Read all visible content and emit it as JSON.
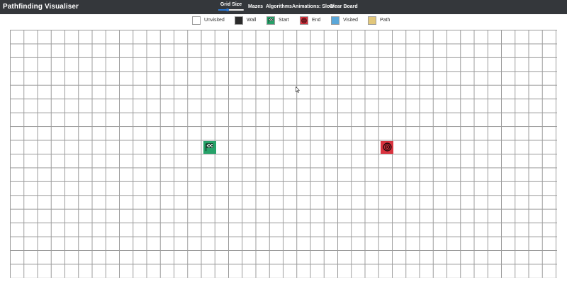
{
  "app": {
    "title": "Pathfinding Visualiser"
  },
  "nav": {
    "grid_size_label": "Grid Size",
    "grid_size_value": 0.35,
    "mazes_label": "Mazes",
    "algorithms_label": "Algorithms",
    "animations_label": "Animations: Slow",
    "clear_board_label": "Clear Board"
  },
  "legend": {
    "items": [
      {
        "label": "Unvisited",
        "color": "#ffffff",
        "icon": "none"
      },
      {
        "label": "Wall",
        "color": "#2b2b2b",
        "icon": "none"
      },
      {
        "label": "Start",
        "color": "#26a269",
        "icon": "checkered-flag-icon"
      },
      {
        "label": "End",
        "color": "#d9333f",
        "icon": "target-icon"
      },
      {
        "label": "Visited",
        "color": "#5aa7d9",
        "icon": "none"
      },
      {
        "label": "Path",
        "color": "#e2c77a",
        "icon": "none"
      }
    ]
  },
  "board": {
    "start_color": "#26a269",
    "end_color": "#d9333f"
  }
}
